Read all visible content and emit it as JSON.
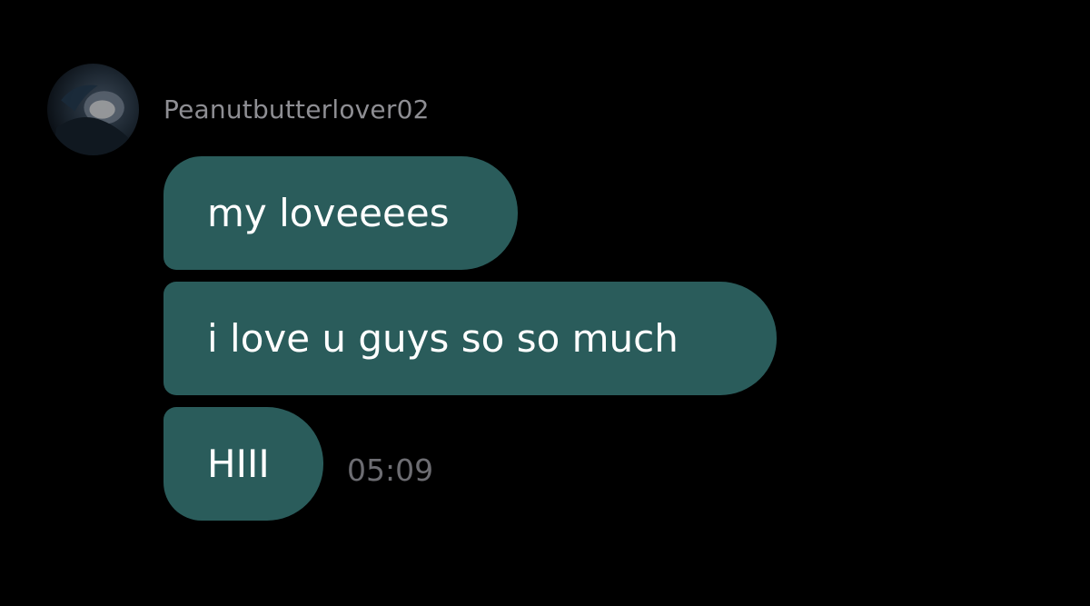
{
  "conversation": {
    "sender_name": "Peanutbutterlover02",
    "avatar_icon": "profile-photo",
    "messages": [
      {
        "text": "my loveeees"
      },
      {
        "text": "i love u guys so so much"
      },
      {
        "text": "HIII"
      }
    ],
    "last_timestamp": "05:09"
  },
  "colors": {
    "background": "#000000",
    "bubble": "#2a5c5b",
    "bubble_text": "#ffffff",
    "sender_text": "#8e8e93",
    "timestamp_text": "#6d6d72"
  }
}
